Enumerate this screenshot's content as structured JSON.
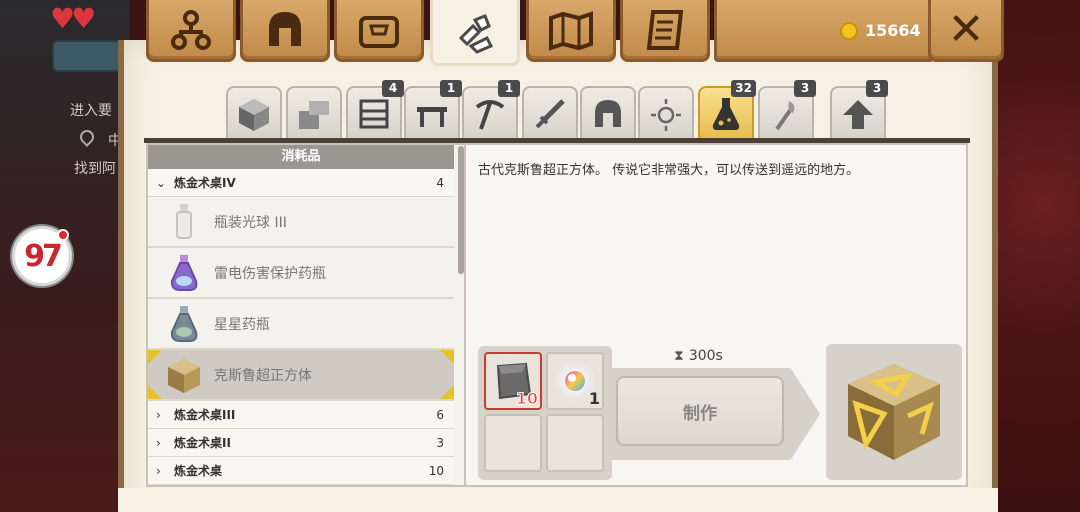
{
  "currency": {
    "coins": "15664",
    "icon": "coin-icon"
  },
  "top_tabs": [
    {
      "name": "skills-tab",
      "icon": "skill-tree-icon",
      "active": false
    },
    {
      "name": "armor-tab",
      "icon": "helmet-icon",
      "active": false
    },
    {
      "name": "inventory-tab",
      "icon": "backpack-icon",
      "active": false
    },
    {
      "name": "crafting-tab",
      "icon": "crafting-hands-icon",
      "active": true
    },
    {
      "name": "map-tab",
      "icon": "map-icon",
      "active": false
    },
    {
      "name": "quests-tab",
      "icon": "scroll-icon",
      "active": false
    }
  ],
  "category_tabs": [
    {
      "icon": "block-icon",
      "badge": ""
    },
    {
      "icon": "stone-bricks-icon",
      "badge": ""
    },
    {
      "icon": "furniture-shelf-icon",
      "badge": "4"
    },
    {
      "icon": "table-icon",
      "badge": "1"
    },
    {
      "icon": "pickaxe-icon",
      "badge": "1"
    },
    {
      "icon": "sword-icon",
      "badge": ""
    },
    {
      "icon": "helmet-icon",
      "badge": ""
    },
    {
      "icon": "sparkle-icon",
      "badge": ""
    },
    {
      "icon": "potion-flask-icon",
      "badge": "32",
      "active": true
    },
    {
      "icon": "torch-icon",
      "badge": "3"
    },
    {
      "icon": "upgrade-arrow-icon",
      "badge": "3"
    }
  ],
  "list": {
    "header": "消耗品",
    "groups": [
      {
        "name": "炼金术桌IV",
        "count": "4",
        "expanded": true,
        "items": [
          {
            "name": "瓶装光球 III",
            "icon": "bottled-light-icon",
            "selected": false
          },
          {
            "name": "雷电伤害保护药瓶",
            "icon": "lightning-potion-icon",
            "selected": false
          },
          {
            "name": "星星药瓶",
            "icon": "star-potion-icon",
            "selected": false
          },
          {
            "name": "克斯鲁超正方体",
            "icon": "tesseract-cube-icon",
            "selected": true
          }
        ]
      },
      {
        "name": "炼金术桌III",
        "count": "6",
        "expanded": false
      },
      {
        "name": "炼金术桌II",
        "count": "3",
        "expanded": false
      },
      {
        "name": "炼金术桌",
        "count": "10",
        "expanded": false
      }
    ]
  },
  "detail": {
    "description": "古代克斯鲁超正方体。 传说它非常强大，可以传送到遥远的地方。",
    "ingredients": [
      {
        "icon": "stone-block-icon",
        "count": "10",
        "insufficient": true
      },
      {
        "icon": "rainbow-orb-icon",
        "count": "1",
        "insufficient": false
      }
    ],
    "craft_time": "300s",
    "craft_button": "制作",
    "result_icon": "tesseract-cube-icon"
  },
  "background": {
    "texts": [
      "进入要",
      "中",
      "找到阿"
    ]
  }
}
